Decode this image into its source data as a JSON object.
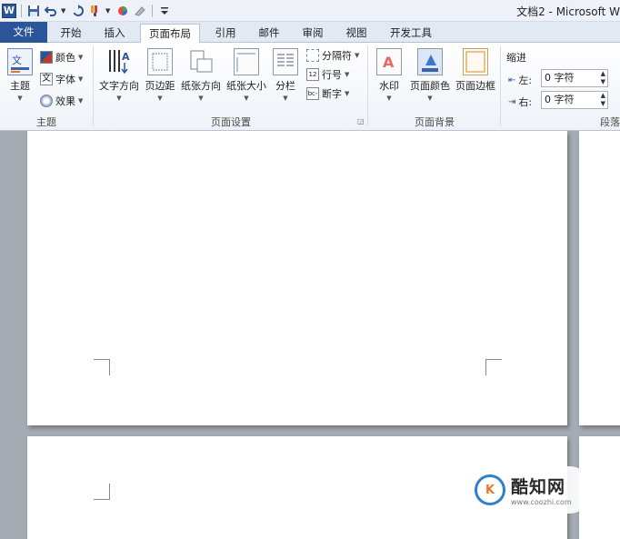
{
  "titlebar": {
    "app_icon_letter": "W",
    "title": "文档2 - Microsoft W"
  },
  "tabs": [
    "文件",
    "开始",
    "插入",
    "页面布局",
    "引用",
    "邮件",
    "审阅",
    "视图",
    "开发工具"
  ],
  "active_tab": "页面布局",
  "ribbon": {
    "theme": {
      "theme_label": "主题",
      "colors_label": "颜色",
      "fonts_label": "字体",
      "effects_label": "效果",
      "group_label": "主题"
    },
    "page_setup": {
      "text_direction": "文字方向",
      "margins": "页边距",
      "orientation": "纸张方向",
      "size": "纸张大小",
      "columns": "分栏",
      "breaks": "分隔符",
      "line_numbers": "行号",
      "hyphenation": "断字",
      "group_label": "页面设置"
    },
    "page_background": {
      "watermark": "水印",
      "page_color": "页面颜色",
      "page_borders": "页面边框",
      "group_label": "页面背景"
    },
    "paragraph": {
      "indent_label": "缩进",
      "left_label": "左:",
      "left_value": "0 字符",
      "right_label": "右:",
      "right_value": "0 字符",
      "group_label": "段落"
    }
  },
  "watermark_logo": {
    "mark": "K",
    "name": "酷知网",
    "url": "www.coozhi.com"
  }
}
